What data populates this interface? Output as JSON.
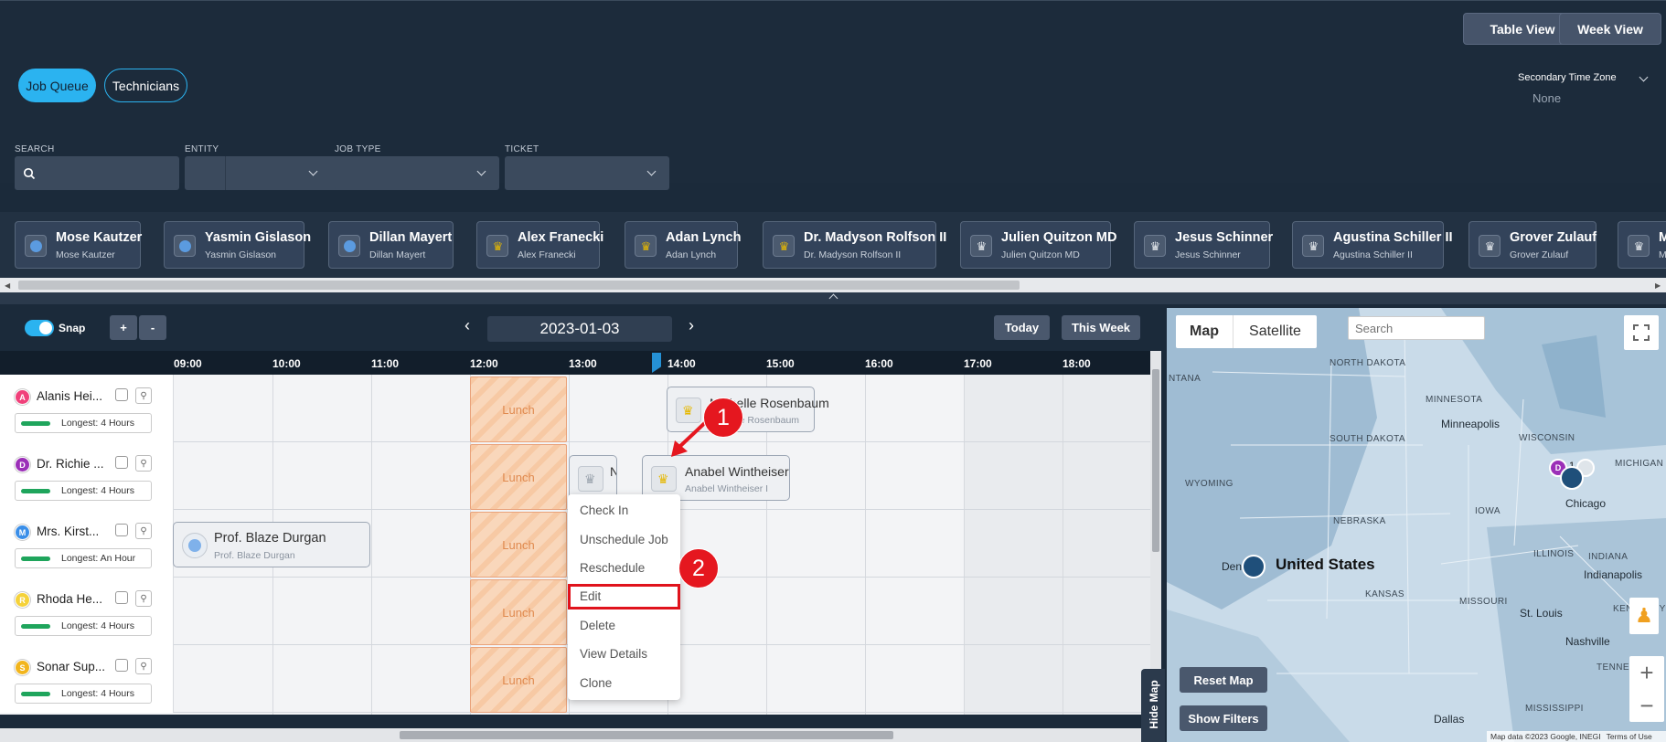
{
  "toolbar": {
    "table_view": "Table View",
    "week_view": "Week View"
  },
  "tabs": {
    "job_queue": "Job Queue",
    "technicians": "Technicians"
  },
  "secondary_tz": {
    "label": "Secondary Time Zone",
    "value": "None"
  },
  "filters": {
    "search": "SEARCH",
    "entity": "ENTITY",
    "job_type": "JOB TYPE",
    "ticket": "TICKET"
  },
  "technicians": [
    {
      "name": "Mose Kautzer",
      "sub": "Mose Kautzer",
      "icon": "dot"
    },
    {
      "name": "Yasmin Gislason",
      "sub": "Yasmin Gislason",
      "icon": "dot"
    },
    {
      "name": "Dillan Mayert",
      "sub": "Dillan Mayert",
      "icon": "dot"
    },
    {
      "name": "Alex Franecki",
      "sub": "Alex Franecki",
      "icon": "chef-gold"
    },
    {
      "name": "Adan Lynch",
      "sub": "Adan Lynch",
      "icon": "chef-gold"
    },
    {
      "name": "Dr. Madyson Rolfson II",
      "sub": "Dr. Madyson Rolfson II",
      "icon": "chef-gold"
    },
    {
      "name": "Julien Quitzon MD",
      "sub": "Julien Quitzon MD",
      "icon": "chef-gray"
    },
    {
      "name": "Jesus Schinner",
      "sub": "Jesus Schinner",
      "icon": "chef-gray"
    },
    {
      "name": "Agustina Schiller II",
      "sub": "Agustina Schiller II",
      "icon": "chef-gray"
    },
    {
      "name": "Grover Zulauf",
      "sub": "Grover Zulauf",
      "icon": "chef-gray"
    },
    {
      "name": "M",
      "sub": "M",
      "icon": "chef-gray"
    }
  ],
  "scheduler": {
    "snap": "Snap",
    "plus": "+",
    "minus": "-",
    "prev": "‹",
    "next": "›",
    "date": "2023-01-03",
    "today": "Today",
    "this_week": "This Week"
  },
  "hours": [
    "09:00",
    "10:00",
    "11:00",
    "12:00",
    "13:00",
    "14:00",
    "15:00",
    "16:00",
    "17:00",
    "18:00"
  ],
  "rows": [
    {
      "initial": "A",
      "name": "Alanis Hei...",
      "color": "#f0407a",
      "longest": "Longest: 4 Hours"
    },
    {
      "initial": "D",
      "name": "Dr. Richie ...",
      "color": "#9b2fb8",
      "longest": "Longest: 4 Hours"
    },
    {
      "initial": "M",
      "name": "Mrs. Kirst...",
      "color": "#3a8ee8",
      "longest": "Longest: An Hour"
    },
    {
      "initial": "R",
      "name": "Rhoda He...",
      "color": "#f5d23a",
      "longest": "Longest: 4 Hours"
    },
    {
      "initial": "S",
      "name": "Sonar Sup...",
      "color": "#f2b51d",
      "longest": "Longest: 4 Hours"
    }
  ],
  "lunch": "Lunch",
  "jobs": {
    "job1": {
      "name": "Michelle Rosenbaum",
      "sub": "Michelle Rosenbaum"
    },
    "job2": {
      "name": "Anabel Wintheiser",
      "sub": "Anabel Wintheiser I"
    },
    "job3": {
      "name": "Prof. Blaze Durgan",
      "sub": "Prof. Blaze Durgan"
    },
    "job_small": {
      "name": "N"
    }
  },
  "context_menu": [
    "Check In",
    "Unschedule Job",
    "Reschedule",
    "Edit",
    "Delete",
    "View Details",
    "Clone"
  ],
  "map": {
    "map_tab": "Map",
    "satellite_tab": "Satellite",
    "search_placeholder": "Search",
    "reset": "Reset Map",
    "show_filters": "Show Filters",
    "hide_map": "Hide Map",
    "country": "United States",
    "labels": [
      "NORTH DAKOTA",
      "MINNESOTA",
      "SOUTH DAKOTA",
      "WISCONSIN",
      "MICHIGAN",
      "WYOMING",
      "NEBRASKA",
      "IOWA",
      "ILLINOIS",
      "INDIANA",
      "KANSAS",
      "MISSOURI",
      "KENTUCKY",
      "TENNESSEE",
      "MISSISSIPPI",
      "NTANA"
    ],
    "cities": [
      "Minneapolis",
      "Chicago",
      "Indianapolis",
      "St. Louis",
      "Nashville",
      "Dallas",
      "Den"
    ],
    "copyright": "Map data ©2023 Google, INEGI",
    "terms": "Terms of Use"
  },
  "callouts": [
    "1",
    "2"
  ]
}
